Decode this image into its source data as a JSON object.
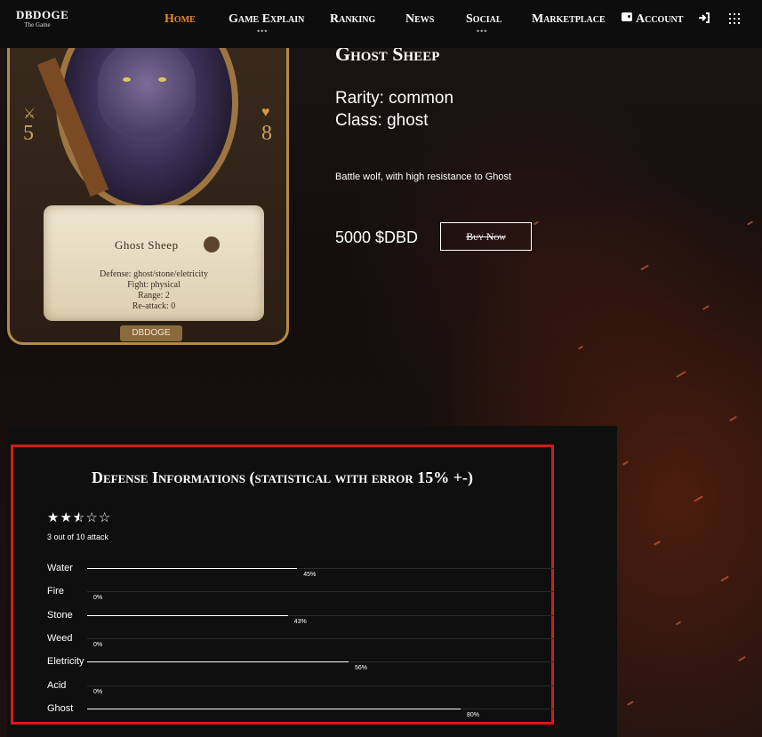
{
  "header": {
    "logo_line1": "DBDOGE",
    "logo_line2": "The Game",
    "nav": [
      {
        "label": "Home",
        "active": true
      },
      {
        "label": "Game Explain",
        "has_submenu": true
      },
      {
        "label": "Ranking"
      },
      {
        "label": "News"
      },
      {
        "label": "Social",
        "has_submenu": true
      },
      {
        "label": "Marketplace"
      },
      {
        "label": "Account"
      }
    ],
    "icons": [
      "wallet-icon",
      "sign-in-icon",
      "apps-grid-icon"
    ]
  },
  "card": {
    "name": "Ghost Sheep",
    "attack": "5",
    "health": "8",
    "lines": [
      "Defense: ghost/stone/eletricity",
      "Fight: physical",
      "Range: 2",
      "Re-attack: 0"
    ],
    "brand": "DBDOGE"
  },
  "item": {
    "title": "Ghost Sheep",
    "rarity": "Rarity: common",
    "class": "Class: ghost",
    "description": "Battle wolf, with high resistance to Ghost",
    "price": "5000 $DBD",
    "buy_label": "Buy Now"
  },
  "defense": {
    "title": "Defense Informations (statistical with error 15% +-)",
    "rating": 2.5,
    "rating_max": 5,
    "attack_text": "3 out of 10 attack",
    "rows": [
      {
        "label": "Water",
        "value": 45,
        "pct": "45%"
      },
      {
        "label": "Fire",
        "value": 0,
        "pct": "0%"
      },
      {
        "label": "Stone",
        "value": 43,
        "pct": "43%"
      },
      {
        "label": "Weed",
        "value": 0,
        "pct": "0%"
      },
      {
        "label": "Eletricity",
        "value": 56,
        "pct": "56%"
      },
      {
        "label": "Acid",
        "value": 0,
        "pct": "0%"
      },
      {
        "label": "Ghost",
        "value": 80,
        "pct": "80%"
      }
    ]
  },
  "colors": {
    "accent": "#e8862b",
    "highlight_border": "#d81818",
    "panel": "#0f0f0f"
  }
}
